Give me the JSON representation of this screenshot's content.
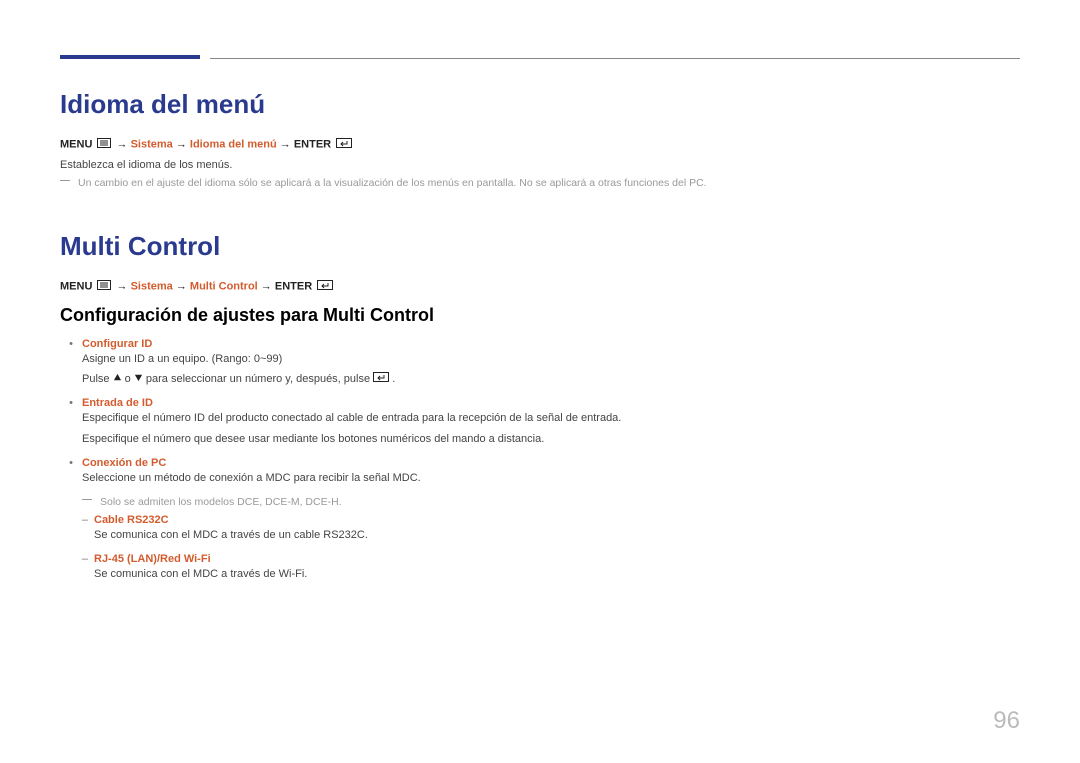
{
  "section1": {
    "heading": "Idioma del menú",
    "nav": {
      "menu_label": "MENU",
      "arrow": "→",
      "sistema": "Sistema",
      "page": "Idioma del menú",
      "enter_label": "ENTER"
    },
    "body": "Establezca el idioma de los menús.",
    "note": "Un cambio en el ajuste del idioma sólo se aplicará a la visualización de los menús en pantalla. No se aplicará a otras funciones del PC."
  },
  "section2": {
    "heading": "Multi Control",
    "nav": {
      "menu_label": "MENU",
      "arrow": "→",
      "sistema": "Sistema",
      "page": "Multi Control",
      "enter_label": "ENTER"
    },
    "subhead": "Configuración de ajustes para Multi Control",
    "items": [
      {
        "title": "Configurar ID",
        "body1": "Asigne un ID a un equipo. (Rango: 0~99)",
        "body2_pre": "Pulse ",
        "body2_mid": " o ",
        "body2_post": " para seleccionar un número y, después, pulse ",
        "body2_end": "."
      },
      {
        "title": "Entrada de ID",
        "body1": "Especifique el número ID del producto conectado al cable de entrada para la recepción de la señal de entrada.",
        "body2": "Especifique el número que desee usar mediante los botones numéricos del mando a distancia."
      },
      {
        "title": "Conexión de PC",
        "body1": "Seleccione un método de conexión a MDC para recibir la señal MDC.",
        "note": "Solo se admiten los modelos DCE, DCE-M, DCE-H.",
        "sub": [
          {
            "title": "Cable RS232C",
            "body": "Se comunica con el MDC a través de un cable RS232C."
          },
          {
            "title": "RJ-45 (LAN)/Red Wi-Fi",
            "body": "Se comunica con el MDC a través de Wi-Fi."
          }
        ]
      }
    ]
  },
  "page_number": "96"
}
